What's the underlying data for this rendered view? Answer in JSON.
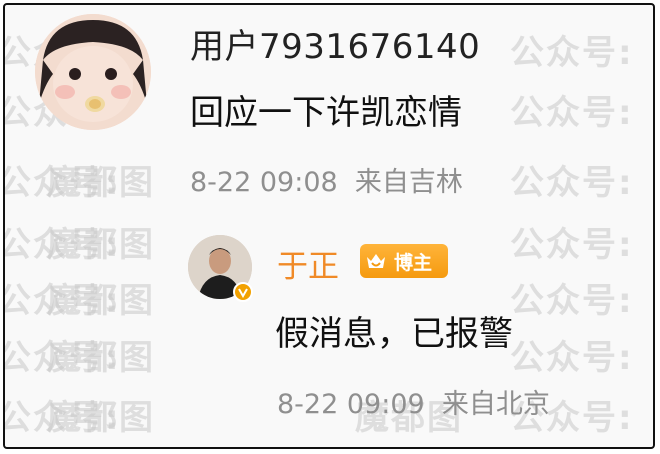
{
  "watermark": {
    "text_a": "魔都图",
    "text_b": "公众号:"
  },
  "comment": {
    "username": "用户7931676140",
    "text": "回应一下许凯恋情",
    "time": "8-22 09:08",
    "location": "来自吉林"
  },
  "reply": {
    "username": "于正",
    "badge_label": "博主",
    "text": "假消息，已报警",
    "time": "8-22 09:09",
    "location": "来自北京"
  },
  "colors": {
    "reply_name": "#f08a27",
    "badge": "#f59a0f",
    "meta_text": "#8f8f8f"
  }
}
